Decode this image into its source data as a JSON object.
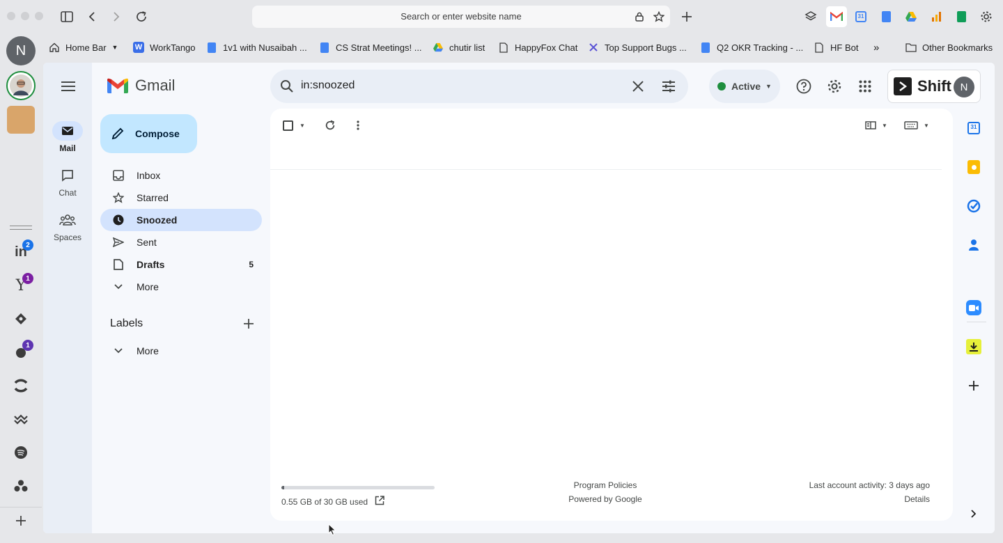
{
  "browser": {
    "url_placeholder": "Search or enter website name",
    "extensions": [
      "layers-icon",
      "gmail-icon",
      "calendar-icon",
      "docs-icon",
      "drive-icon",
      "analytics-icon",
      "sheets-icon",
      "gear-icon"
    ]
  },
  "bookmarks": [
    {
      "label": "Home Bar",
      "icon": "home-icon"
    },
    {
      "label": "WorkTango",
      "icon": "worktango-icon"
    },
    {
      "label": "1v1 with Nusaibah ...",
      "icon": "docs-icon"
    },
    {
      "label": "CS Strat Meetings! ...",
      "icon": "docs-icon"
    },
    {
      "label": "chutir list",
      "icon": "drive-icon"
    },
    {
      "label": "HappyFox Chat",
      "icon": "page-icon"
    },
    {
      "label": "Top Support Bugs ...",
      "icon": "jira-icon"
    },
    {
      "label": "Q2 OKR Tracking - ...",
      "icon": "docs-icon"
    },
    {
      "label": "HF Bot",
      "icon": "page-icon"
    },
    {
      "label": "Other Bookmarks",
      "icon": "folder-icon"
    }
  ],
  "shift_rail": {
    "account_initial": "N",
    "badges": {
      "linkedin": "2",
      "yahoo": "1",
      "app": "1"
    }
  },
  "gmail": {
    "logo_text": "Gmail",
    "rail": {
      "mail": "Mail",
      "chat": "Chat",
      "spaces": "Spaces"
    },
    "search_value": "in:snoozed",
    "status": "Active",
    "shift_text": "Shift",
    "account_initial": "N",
    "compose": "Compose",
    "nav": {
      "inbox": "Inbox",
      "starred": "Starred",
      "snoozed": "Snoozed",
      "sent": "Sent",
      "drafts": "Drafts",
      "drafts_count": "5",
      "more": "More"
    },
    "labels": {
      "title": "Labels",
      "more": "More"
    },
    "footer": {
      "storage": "0.55 GB of 30 GB used",
      "storage_fraction": 0.018,
      "program_policies": "Program Policies",
      "powered_by": "Powered by Google",
      "last_activity": "Last account activity: 3 days ago",
      "details": "Details"
    }
  }
}
